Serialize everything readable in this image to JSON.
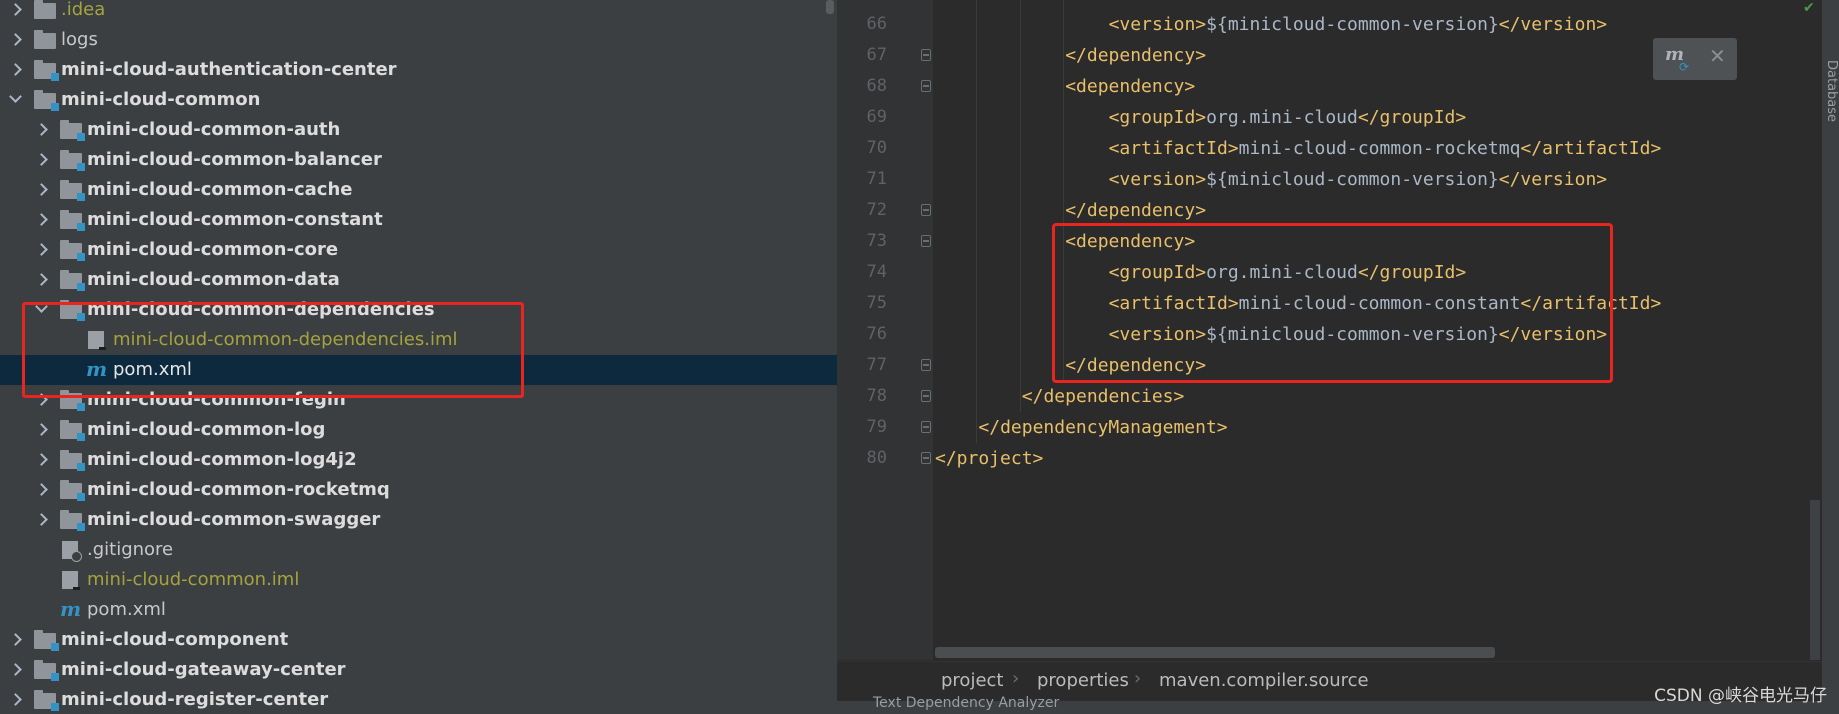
{
  "tree": {
    "rows": [
      {
        "label": ".idea",
        "style": "yellow",
        "depth": 0,
        "chevron": "closed",
        "icon": "folder-icon"
      },
      {
        "label": "logs",
        "style": "plain",
        "depth": 0,
        "chevron": "closed",
        "icon": "folder-icon"
      },
      {
        "label": "mini-cloud-authentication-center",
        "style": "mod",
        "depth": 0,
        "chevron": "closed",
        "icon": "module-folder-icon"
      },
      {
        "label": "mini-cloud-common",
        "style": "mod",
        "depth": 0,
        "chevron": "open",
        "icon": "module-folder-icon"
      },
      {
        "label": "mini-cloud-common-auth",
        "style": "mod",
        "depth": 1,
        "chevron": "closed",
        "icon": "module-folder-icon"
      },
      {
        "label": "mini-cloud-common-balancer",
        "style": "mod",
        "depth": 1,
        "chevron": "closed",
        "icon": "module-folder-icon"
      },
      {
        "label": "mini-cloud-common-cache",
        "style": "mod",
        "depth": 1,
        "chevron": "closed",
        "icon": "module-folder-icon"
      },
      {
        "label": "mini-cloud-common-constant",
        "style": "mod",
        "depth": 1,
        "chevron": "closed",
        "icon": "module-folder-icon"
      },
      {
        "label": "mini-cloud-common-core",
        "style": "mod",
        "depth": 1,
        "chevron": "closed",
        "icon": "module-folder-icon"
      },
      {
        "label": "mini-cloud-common-data",
        "style": "mod",
        "depth": 1,
        "chevron": "closed",
        "icon": "module-folder-icon"
      },
      {
        "label": "mini-cloud-common-dependencies",
        "style": "mod",
        "depth": 1,
        "chevron": "open",
        "icon": "module-folder-icon"
      },
      {
        "label": "mini-cloud-common-dependencies.iml",
        "style": "yellow",
        "depth": 2,
        "chevron": "none",
        "icon": "iml-file-icon"
      },
      {
        "label": "pom.xml",
        "style": "sel",
        "depth": 2,
        "chevron": "none",
        "icon": "maven-m-icon",
        "selected": true
      },
      {
        "label": "mini-cloud-common-fegin",
        "style": "mod",
        "depth": 1,
        "chevron": "closed",
        "icon": "module-folder-icon"
      },
      {
        "label": "mini-cloud-common-log",
        "style": "mod",
        "depth": 1,
        "chevron": "closed",
        "icon": "module-folder-icon"
      },
      {
        "label": "mini-cloud-common-log4j2",
        "style": "mod",
        "depth": 1,
        "chevron": "closed",
        "icon": "module-folder-icon"
      },
      {
        "label": "mini-cloud-common-rocketmq",
        "style": "mod",
        "depth": 1,
        "chevron": "closed",
        "icon": "module-folder-icon"
      },
      {
        "label": "mini-cloud-common-swagger",
        "style": "mod",
        "depth": 1,
        "chevron": "closed",
        "icon": "module-folder-icon"
      },
      {
        "label": ".gitignore",
        "style": "plain",
        "depth": 1,
        "chevron": "none",
        "icon": "ignored-file-icon"
      },
      {
        "label": "mini-cloud-common.iml",
        "style": "yellow",
        "depth": 1,
        "chevron": "none",
        "icon": "iml-file-icon"
      },
      {
        "label": "pom.xml",
        "style": "plain",
        "depth": 1,
        "chevron": "none",
        "icon": "maven-m-icon"
      },
      {
        "label": "mini-cloud-component",
        "style": "mod",
        "depth": 0,
        "chevron": "closed",
        "icon": "module-folder-icon"
      },
      {
        "label": "mini-cloud-gateaway-center",
        "style": "mod",
        "depth": 0,
        "chevron": "closed",
        "icon": "module-folder-icon"
      },
      {
        "label": "mini-cloud-register-center",
        "style": "mod",
        "depth": 0,
        "chevron": "closed",
        "icon": "module-folder-icon"
      }
    ]
  },
  "editor": {
    "lines": [
      {
        "n": "66",
        "indent": 4,
        "parts": [
          [
            "t",
            "<version>"
          ],
          [
            "x",
            "${minicloud-common-version}"
          ],
          [
            "t",
            "</version>"
          ]
        ]
      },
      {
        "n": "67",
        "indent": 3,
        "fold": true,
        "parts": [
          [
            "t",
            "</dependency>"
          ]
        ]
      },
      {
        "n": "68",
        "indent": 3,
        "fold": true,
        "parts": [
          [
            "t",
            "<dependency>"
          ]
        ]
      },
      {
        "n": "69",
        "indent": 4,
        "parts": [
          [
            "t",
            "<groupId>"
          ],
          [
            "x",
            "org.mini-cloud"
          ],
          [
            "t",
            "</groupId>"
          ]
        ]
      },
      {
        "n": "70",
        "indent": 4,
        "parts": [
          [
            "t",
            "<artifactId>"
          ],
          [
            "x",
            "mini-cloud-common-rocketmq"
          ],
          [
            "t",
            "</artifactId>"
          ]
        ]
      },
      {
        "n": "71",
        "indent": 4,
        "parts": [
          [
            "t",
            "<version>"
          ],
          [
            "x",
            "${minicloud-common-version}"
          ],
          [
            "t",
            "</version>"
          ]
        ]
      },
      {
        "n": "72",
        "indent": 3,
        "fold": true,
        "parts": [
          [
            "t",
            "</dependency>"
          ]
        ]
      },
      {
        "n": "73",
        "indent": 3,
        "fold": true,
        "parts": [
          [
            "t",
            "<dependency>"
          ]
        ]
      },
      {
        "n": "74",
        "indent": 4,
        "parts": [
          [
            "t",
            "<groupId>"
          ],
          [
            "x",
            "org.mini-cloud"
          ],
          [
            "t",
            "</groupId>"
          ]
        ]
      },
      {
        "n": "75",
        "indent": 4,
        "parts": [
          [
            "t",
            "<artifactId>"
          ],
          [
            "x",
            "mini-cloud-common-constant"
          ],
          [
            "t",
            "</artifactId>"
          ]
        ]
      },
      {
        "n": "76",
        "indent": 4,
        "parts": [
          [
            "t",
            "<version>"
          ],
          [
            "x",
            "${minicloud-common-version}"
          ],
          [
            "t",
            "</version>"
          ]
        ]
      },
      {
        "n": "77",
        "indent": 3,
        "fold": true,
        "parts": [
          [
            "t",
            "</dependency>"
          ]
        ]
      },
      {
        "n": "78",
        "indent": 2,
        "fold": true,
        "parts": [
          [
            "t",
            "</dependencies>"
          ]
        ]
      },
      {
        "n": "79",
        "indent": 1,
        "fold": true,
        "parts": [
          [
            "t",
            "</dependencyManagement>"
          ]
        ]
      },
      {
        "n": "80",
        "indent": 0,
        "fold": true,
        "parts": [
          [
            "t",
            "</project>"
          ]
        ]
      }
    ],
    "breadcrumbs": [
      "project",
      "properties",
      "maven.compiler.source"
    ],
    "right_tool_label": "Database",
    "bottom_tabs": "Text   Dependency Analyzer"
  },
  "watermark": "CSDN @峡谷电光马仔",
  "colors": {
    "highlight": "#e8261f",
    "tag": "#e8bf6a",
    "text": "#a9b7c6",
    "selection": "#0d293e"
  }
}
